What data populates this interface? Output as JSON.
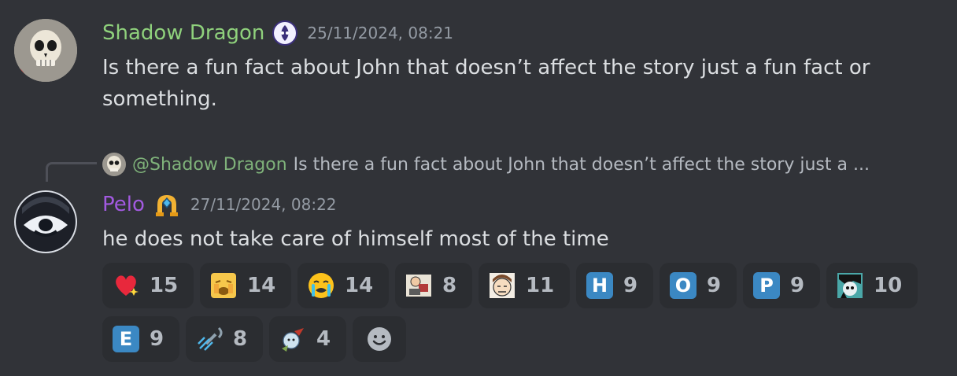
{
  "message1": {
    "username": "Shadow Dragon",
    "username_color": "#8fd17c",
    "timestamp": "25/11/2024, 08:21",
    "line1": "Is there a fun fact about John that doesn’t affect the story just a fun fact or",
    "line2": "something."
  },
  "reply": {
    "mention": "@Shadow Dragon",
    "preview": "Is there a fun fact about John that doesn’t affect the story just a ..."
  },
  "message2": {
    "username": "Pelo",
    "username_color": "#9b59d6",
    "timestamp": "27/11/2024, 08:22",
    "content": "he does not take care of himself most of the time"
  },
  "reactions": [
    {
      "emoji": "sparkling-heart-icon",
      "count": "15"
    },
    {
      "emoji": "yellow-face-icon",
      "count": "14"
    },
    {
      "emoji": "crying-face-icon",
      "count": "14"
    },
    {
      "emoji": "custom-sticker-icon",
      "count": "8"
    },
    {
      "emoji": "custom-face-icon",
      "count": "11"
    },
    {
      "emoji": "letter-h-icon",
      "letter": "H",
      "count": "9"
    },
    {
      "emoji": "letter-o-icon",
      "letter": "O",
      "count": "9"
    },
    {
      "emoji": "letter-p-icon",
      "letter": "P",
      "count": "9"
    },
    {
      "emoji": "custom-character-icon",
      "count": "10"
    },
    {
      "emoji": "letter-e-icon",
      "letter": "E",
      "count": "9"
    },
    {
      "emoji": "shower-icon",
      "count": "8"
    },
    {
      "emoji": "custom-sticker-2-icon",
      "count": "4"
    }
  ],
  "add_reaction": {
    "emoji": "add-reaction-smiley-icon"
  }
}
